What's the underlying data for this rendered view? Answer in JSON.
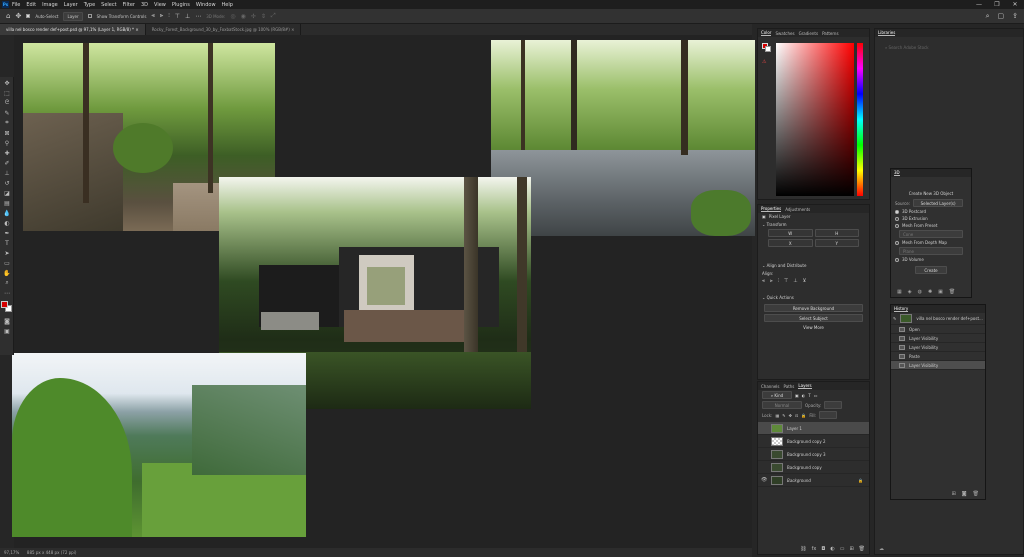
{
  "app": {
    "logo": "Ps"
  },
  "menu": [
    "File",
    "Edit",
    "Image",
    "Layer",
    "Type",
    "Select",
    "Filter",
    "3D",
    "View",
    "Plugins",
    "Window",
    "Help"
  ],
  "window_controls": [
    "—",
    "❐",
    "✕"
  ],
  "options_bar": {
    "auto_select": "Auto-Select",
    "layer_dropdown": "Layer",
    "transform_controls": "Show Transform Controls",
    "mode_3d": "3D Mode:"
  },
  "tabs": [
    {
      "label": "villa nel bosco render def+post.psd @ 97,1% (Layer 1, RGB/8) *",
      "active": true
    },
    {
      "label": "Rocky_Forest_Background_30_by_FoxbatStock.jpg @ 100% (RGB/8#)",
      "active": false
    }
  ],
  "status": {
    "zoom": "97,17%",
    "doc": "885 px x 448 px (72 ppi)"
  },
  "color_panel": {
    "tabs": [
      "Color",
      "Swatches",
      "Gradients",
      "Patterns"
    ],
    "fg": "#d40000",
    "bg": "#ffffff"
  },
  "properties": {
    "tabs": [
      "Properties",
      "Adjustments"
    ],
    "layer_type": "Pixel Layer",
    "transform": "Transform",
    "fields": {
      "w": "W",
      "h": "H",
      "x": "X",
      "y": "Y"
    },
    "align": "Align and Distribute",
    "align_label": "Align:",
    "quick": "Quick Actions",
    "remove_bg": "Remove Background",
    "select_subject": "Select Subject",
    "view_more": "View More"
  },
  "layers": {
    "tabs": [
      "Channels",
      "Paths",
      "Layers"
    ],
    "kind": "Kind",
    "blend": "Normal",
    "opacity": "Opacity:",
    "lock": "Lock:",
    "fill": "Fill:",
    "rows": [
      {
        "name": "Layer 1",
        "selected": true,
        "visible": false
      },
      {
        "name": "Background copy 2",
        "selected": false,
        "visible": false
      },
      {
        "name": "Background copy 3",
        "selected": false,
        "visible": false
      },
      {
        "name": "Background copy",
        "selected": false,
        "visible": false
      },
      {
        "name": "Background",
        "selected": false,
        "visible": true
      }
    ]
  },
  "libraries": {
    "title": "Libraries",
    "search": "Search Adobe Stock"
  },
  "panel_3d": {
    "title": "3D",
    "heading": "Create New 3D Object",
    "source_label": "Source:",
    "source": "Selected Layer(s)",
    "options": [
      "3D Postcard",
      "3D Extrusion",
      "Mesh From Preset",
      "Mesh From Depth Map",
      "3D Volume"
    ],
    "preset": "Cone",
    "depth": "Plane",
    "create": "Create"
  },
  "history": {
    "title": "History",
    "snapshot": "villa nel bosco render def+post...",
    "items": [
      {
        "label": "Open",
        "selected": false
      },
      {
        "label": "Layer Visibility",
        "selected": false
      },
      {
        "label": "Layer Visibility",
        "selected": false
      },
      {
        "label": "Paste",
        "selected": false
      },
      {
        "label": "Layer Visibility",
        "selected": true
      }
    ]
  }
}
